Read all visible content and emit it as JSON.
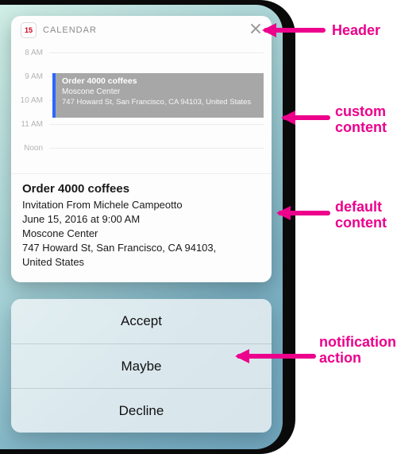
{
  "header": {
    "icon_day": "15",
    "app_name": "CALENDAR"
  },
  "timeline": {
    "hours": [
      "8 AM",
      "9 AM",
      "10 AM",
      "11 AM",
      "Noon"
    ],
    "event": {
      "title": "Order 4000 coffees",
      "location": "Moscone Center",
      "address": "747 Howard St, San Francisco, CA  94103, United States"
    }
  },
  "details": {
    "title": "Order 4000 coffees",
    "invitation": "Invitation From Michele Campeotto",
    "datetime": "June 15, 2016 at 9:00 AM",
    "location": "Moscone Center",
    "address1": "747 Howard St, San Francisco, CA  94103,",
    "address2": "United States"
  },
  "actions": {
    "accept": "Accept",
    "maybe": "Maybe",
    "decline": "Decline"
  },
  "callouts": {
    "header": "Header",
    "custom1": "custom",
    "custom2": "content",
    "default1": "default",
    "default2": "content",
    "action1": "notification",
    "action2": "action"
  }
}
